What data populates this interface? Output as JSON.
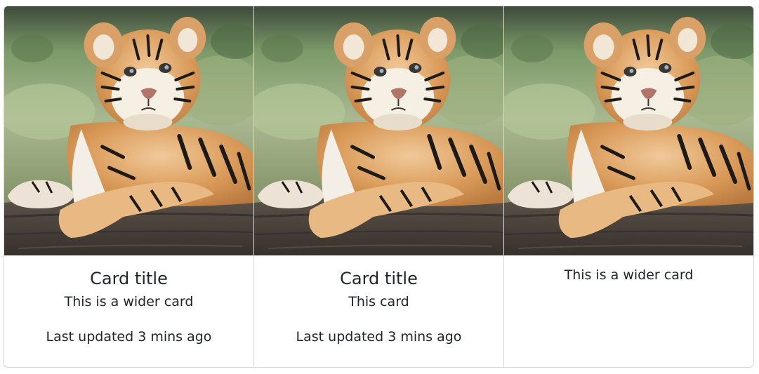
{
  "cards": [
    {
      "image_alt": "Tiger cub lying on a log",
      "title": "Card title",
      "text": "This is a wider card",
      "footer": "Last updated 3 mins ago"
    },
    {
      "image_alt": "Tiger cub lying on a log",
      "title": "Card title",
      "text": "This card",
      "footer": "Last updated 3 mins ago"
    },
    {
      "image_alt": "Tiger cub lying on a log",
      "text": "This is a wider card"
    }
  ],
  "colors": {
    "border": "#d6d8db",
    "text": "#212529",
    "background": "#ffffff"
  }
}
